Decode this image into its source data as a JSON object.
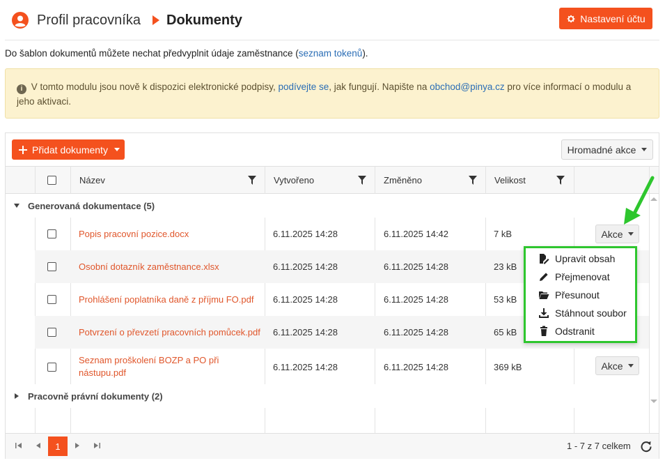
{
  "header": {
    "breadcrumb_parent": "Profil pracovníka",
    "breadcrumb_current": "Dokumenty",
    "settings_button": "Nastavení účtu"
  },
  "intro": {
    "text_before": "Do šablon dokumentů můžete nechat předvyplnit údaje zaměstnance (",
    "link": "seznam tokenů",
    "text_after": ")."
  },
  "alert": {
    "part1": "V tomto modulu jsou nově k dispozici elektronické podpisy, ",
    "link1": "podívejte se",
    "part2": ", jak fungují. Napište na ",
    "link2": "obchod@pinya.cz",
    "part3": " pro více informací o modulu a jeho aktivaci."
  },
  "toolbar": {
    "add_button": "Přidat dokumenty",
    "bulk_button": "Hromadné akce"
  },
  "table": {
    "columns": [
      "Název",
      "Vytvořeno",
      "Změněno",
      "Velikost"
    ],
    "groups": [
      {
        "label": "Generovaná dokumentace (5)",
        "rows": [
          {
            "name": "Popis pracovní pozice.docx",
            "created": "6.11.2025 14:28",
            "modified": "6.11.2025 14:42",
            "size": "7 kB",
            "action": "Akce"
          },
          {
            "name": "Osobní dotazník zaměstnance.xlsx",
            "created": "6.11.2025 14:28",
            "modified": "6.11.2025 14:28",
            "size": "23 kB"
          },
          {
            "name": "Prohlášení poplatníka daně z příjmu FO.pdf",
            "created": "6.11.2025 14:28",
            "modified": "6.11.2025 14:28",
            "size": "53 kB"
          },
          {
            "name": "Potvrzení o převzetí pracovních pomůcek.pdf",
            "created": "6.11.2025 14:28",
            "modified": "6.11.2025 14:28",
            "size": "65 kB"
          },
          {
            "name_line1": "Seznam proškolení BOZP a PO při",
            "name_line2": "nástupu.pdf",
            "created": "6.11.2025 14:28",
            "modified": "6.11.2025 14:28",
            "size": "369 kB",
            "action": "Akce"
          }
        ]
      },
      {
        "label": "Pracovně právní dokumenty (2)"
      }
    ]
  },
  "dropdown": {
    "items": [
      {
        "label": "Upravit obsah",
        "icon": "edit-document-icon"
      },
      {
        "label": "Přejmenovat",
        "icon": "pencil-icon"
      },
      {
        "label": "Přesunout",
        "icon": "folder-open-icon"
      },
      {
        "label": "Stáhnout soubor",
        "icon": "download-icon"
      },
      {
        "label": "Odstranit",
        "icon": "trash-icon"
      }
    ]
  },
  "pagination": {
    "current_page": "1",
    "info": "1 - 7 z 7 celkem"
  },
  "colors": {
    "accent": "#f4511e",
    "link": "#2a6db5",
    "highlight": "#2ec62e",
    "alert_bg": "#fcf2cf"
  }
}
